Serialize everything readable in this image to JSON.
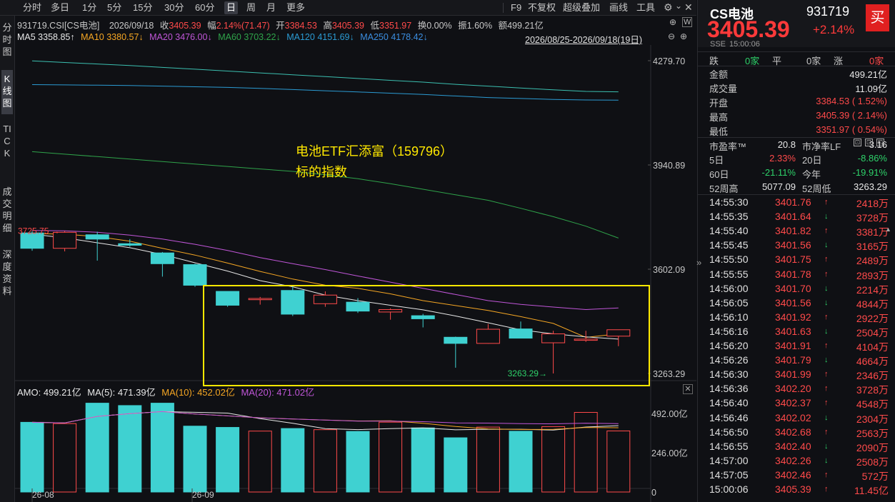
{
  "toolbar": {
    "periods": [
      "分时",
      "多日",
      "1分",
      "5分",
      "15分",
      "30分",
      "60分",
      "日",
      "周",
      "月",
      "更多"
    ],
    "active_period": "日",
    "right_items": [
      "F9",
      "不复权",
      "超级叠加",
      "画线",
      "工具"
    ]
  },
  "side_tabs": [
    "分时图",
    "K线图",
    "TICK",
    "成交明细",
    "深度资料"
  ],
  "info": {
    "code_name": "931719.CSI[CS电池]",
    "date": "2026/09/18",
    "close_label": "收",
    "close": "3405.39",
    "range_label": "幅",
    "range": "2.14%(71.47)",
    "open_label": "开",
    "open": "3384.53",
    "high_label": "高",
    "high": "3405.39",
    "low_label": "低",
    "low": "3351.97",
    "turnover_label": "换",
    "turnover": "0.00%",
    "amplitude_label": "振",
    "amplitude": "1.60%",
    "amount_label": "额",
    "amount": "499.21亿"
  },
  "ma": {
    "ma5": "MA5 3358.85↑",
    "ma10": "MA10 3380.57↓",
    "ma20": "MA20 3476.00↓",
    "ma60": "MA60 3703.22↓",
    "ma120": "MA120 4151.69↓",
    "ma250": "MA250 4178.42↓",
    "date_range": "2026/08/25-2026/09/18(19日)"
  },
  "price_axis": [
    "4279.70",
    "3940.89",
    "3602.09",
    "3263.29"
  ],
  "annotation": {
    "line1": "电池ETF汇添富（159796）",
    "line2": "标的指数"
  },
  "max_label": "3725.75",
  "min_label": "3263.29",
  "volume_info": {
    "amo": "AMO: 499.21亿",
    "ma5": "MA(5): 471.39亿",
    "ma10": "MA(10): 452.02亿",
    "ma20": "MA(20): 471.02亿"
  },
  "volume_axis": [
    "492.00亿",
    "246.00亿",
    "0"
  ],
  "date_axis": [
    "26-08",
    "26-09"
  ],
  "colors": {
    "up": "#ff4a4a",
    "down": "#3fd1d1",
    "highlight": "#ffe800",
    "ma5": "#ffffff",
    "ma10": "#f5a623",
    "ma20": "#c056d8",
    "ma60": "#2fa34a",
    "ma120": "#2b9bd3",
    "ma250": "#3bbfb0"
  },
  "chart_data": {
    "type": "candlestick",
    "ylim": [
      3263.29,
      4279.7
    ],
    "dates": [
      "08-25",
      "08-26",
      "08-27",
      "08-28",
      "08-29",
      "09-01",
      "09-02",
      "09-03",
      "09-04",
      "09-05",
      "09-08",
      "09-09",
      "09-10",
      "09-11",
      "09-12",
      "09-15",
      "09-16",
      "09-17",
      "09-18"
    ],
    "candles": [
      {
        "o": 3720,
        "h": 3726,
        "l": 3662,
        "c": 3670
      },
      {
        "o": 3670,
        "h": 3726,
        "l": 3660,
        "c": 3722
      },
      {
        "o": 3714,
        "h": 3724,
        "l": 3630,
        "c": 3700
      },
      {
        "o": 3685,
        "h": 3700,
        "l": 3675,
        "c": 3680
      },
      {
        "o": 3655,
        "h": 3658,
        "l": 3578,
        "c": 3620
      },
      {
        "o": 3617,
        "h": 3620,
        "l": 3545,
        "c": 3550
      },
      {
        "o": 3530,
        "h": 3530,
        "l": 3480,
        "c": 3485
      },
      {
        "o": 3503,
        "h": 3512,
        "l": 3487,
        "c": 3507
      },
      {
        "o": 3533,
        "h": 3546,
        "l": 3450,
        "c": 3456
      },
      {
        "o": 3490,
        "h": 3530,
        "l": 3480,
        "c": 3518
      },
      {
        "o": 3495,
        "h": 3508,
        "l": 3460,
        "c": 3466
      },
      {
        "o": 3463,
        "h": 3475,
        "l": 3438,
        "c": 3471
      },
      {
        "o": 3451,
        "h": 3457,
        "l": 3413,
        "c": 3441
      },
      {
        "o": 3381,
        "h": 3383,
        "l": 3282,
        "c": 3361
      },
      {
        "o": 3361,
        "h": 3424,
        "l": 3360,
        "c": 3407
      },
      {
        "o": 3408,
        "h": 3432,
        "l": 3382,
        "c": 3378
      },
      {
        "o": 3363,
        "h": 3402,
        "l": 3263.29,
        "c": 3392
      },
      {
        "o": 3371,
        "h": 3402,
        "l": 3366,
        "c": 3375
      },
      {
        "o": 3384.53,
        "h": 3405.39,
        "l": 3351.97,
        "c": 3405.39
      }
    ],
    "volume": [
      437,
      429,
      557,
      542,
      557,
      413,
      405,
      382,
      398,
      391,
      380,
      438,
      402,
      340,
      407,
      381,
      410,
      499.21,
      383
    ],
    "volume_ylim": [
      0,
      600
    ],
    "ma": {
      "ma5": [
        3716,
        3704,
        3688,
        3672,
        3650,
        3623,
        3596,
        3565,
        3545,
        3518,
        3500,
        3485,
        3470,
        3450,
        3428,
        3405,
        3392,
        3382,
        3375
      ],
      "ma10": [
        3718,
        3716,
        3708,
        3693,
        3670,
        3648,
        3622,
        3595,
        3570,
        3550,
        3540,
        3522,
        3500,
        3484,
        3468,
        3448,
        3426,
        3380.57,
        3392
      ],
      "ma20": [
        3728,
        3727,
        3722,
        3713,
        3700,
        3683,
        3663,
        3640,
        3620,
        3601,
        3580,
        3560,
        3540,
        3520,
        3500,
        3488,
        3479,
        3471,
        3476.0
      ],
      "ma60": [
        3984,
        3976,
        3968,
        3960,
        3952,
        3944,
        3936,
        3928,
        3920,
        3909,
        3896,
        3880,
        3862,
        3844,
        3826,
        3800,
        3773,
        3742,
        3703.22
      ],
      "ma120": [
        4202,
        4201,
        4200,
        4199,
        4197,
        4195,
        4193,
        4190,
        4186,
        4182,
        4178,
        4174,
        4170,
        4165,
        4160,
        4157,
        4154,
        4152,
        4151.69
      ],
      "ma250": [
        4279,
        4274,
        4269,
        4264,
        4258,
        4252,
        4246,
        4240,
        4234,
        4228,
        4222,
        4216,
        4210,
        4203,
        4197,
        4191,
        4185,
        4180,
        4178.42
      ]
    }
  },
  "right_panel": {
    "name": "CS电池",
    "code": "931719",
    "buy_button": "买",
    "price": "3405.39",
    "change": "+2.14%",
    "exchange": "SSE",
    "time": "15:00:06",
    "breadth": {
      "down_label": "跌",
      "down": "0家",
      "flat_label": "平",
      "flat": "0家",
      "up_label": "涨",
      "up": "0家"
    },
    "stats": [
      {
        "label": "金额",
        "value": "499.21亿",
        "color": "white"
      },
      {
        "label": "成交量",
        "value": "11.09亿",
        "color": "white"
      },
      {
        "label": "开盘",
        "value": "3384.53 ( 1.52%)",
        "color": "red"
      },
      {
        "label": "最高",
        "value": "3405.39 ( 2.14%)",
        "color": "red"
      },
      {
        "label": "最低",
        "value": "3351.97 ( 0.54%)",
        "color": "red"
      }
    ],
    "pe": {
      "l1": "市盈率™",
      "v1": "20.8",
      "l2": "市净率LF",
      "v2": "3.16"
    },
    "perf": [
      {
        "l1": "5日",
        "v1": "2.33%",
        "c1": "red",
        "l2": "20日",
        "v2": "-8.86%",
        "c2": "green"
      },
      {
        "l1": "60日",
        "v1": "-21.11%",
        "c1": "green",
        "l2": "今年",
        "v2": "-19.91%",
        "c2": "green"
      },
      {
        "l1": "52周高",
        "v1": "5077.09",
        "c1": "white",
        "l2": "52周低",
        "v2": "3263.29",
        "c2": "white"
      }
    ],
    "ticks": [
      {
        "t": "14:55:30",
        "p": "3401.76",
        "d": "up",
        "v": "2418万"
      },
      {
        "t": "14:55:35",
        "p": "3401.64",
        "d": "down",
        "v": "3728万"
      },
      {
        "t": "14:55:40",
        "p": "3401.82",
        "d": "up",
        "v": "3381万"
      },
      {
        "t": "14:55:45",
        "p": "3401.56",
        "d": "down",
        "v": "3165万"
      },
      {
        "t": "14:55:50",
        "p": "3401.75",
        "d": "up",
        "v": "2489万"
      },
      {
        "t": "14:55:55",
        "p": "3401.78",
        "d": "up",
        "v": "2893万"
      },
      {
        "t": "14:56:00",
        "p": "3401.70",
        "d": "down",
        "v": "2214万"
      },
      {
        "t": "14:56:05",
        "p": "3401.56",
        "d": "down",
        "v": "4844万"
      },
      {
        "t": "14:56:10",
        "p": "3401.92",
        "d": "up",
        "v": "2922万"
      },
      {
        "t": "14:56:16",
        "p": "3401.63",
        "d": "down",
        "v": "2504万"
      },
      {
        "t": "14:56:20",
        "p": "3401.91",
        "d": "up",
        "v": "4104万"
      },
      {
        "t": "14:56:26",
        "p": "3401.79",
        "d": "down",
        "v": "4664万"
      },
      {
        "t": "14:56:30",
        "p": "3401.99",
        "d": "up",
        "v": "2346万"
      },
      {
        "t": "14:56:36",
        "p": "3402.20",
        "d": "up",
        "v": "3728万"
      },
      {
        "t": "14:56:40",
        "p": "3402.37",
        "d": "up",
        "v": "4548万"
      },
      {
        "t": "14:56:46",
        "p": "3402.02",
        "d": "down",
        "v": "2304万"
      },
      {
        "t": "14:56:50",
        "p": "3402.68",
        "d": "up",
        "v": "2563万"
      },
      {
        "t": "14:56:55",
        "p": "3402.40",
        "d": "down",
        "v": "2090万"
      },
      {
        "t": "14:57:00",
        "p": "3402.26",
        "d": "down",
        "v": "2508万"
      },
      {
        "t": "14:57:05",
        "p": "3402.46",
        "d": "up",
        "v": "572万"
      },
      {
        "t": "15:00:06",
        "p": "3405.39",
        "d": "up",
        "v": "11.45亿"
      }
    ]
  }
}
